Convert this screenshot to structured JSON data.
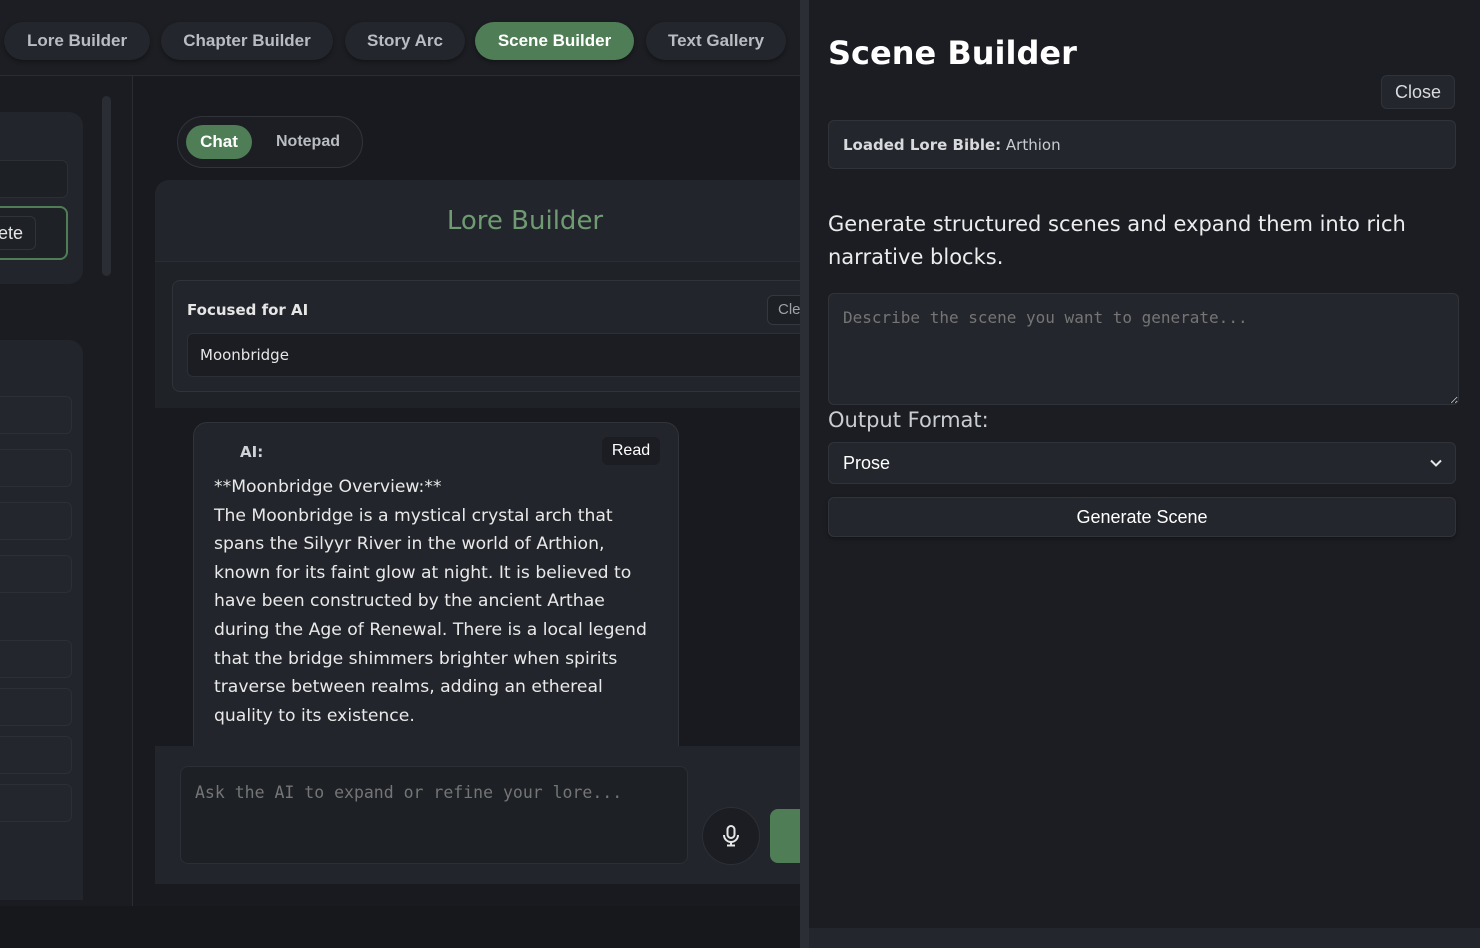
{
  "nav": {
    "tabs": [
      {
        "label": "Lore Builder"
      },
      {
        "label": "Chapter Builder"
      },
      {
        "label": "Story Arc"
      },
      {
        "label": "Scene Builder",
        "active": true
      },
      {
        "label": "Text Gallery"
      }
    ]
  },
  "left": {
    "delete_label": "Delete"
  },
  "chat": {
    "toggle": {
      "chat": "Chat",
      "notepad": "Notepad",
      "active": "Chat"
    },
    "panel_title": "Lore Builder",
    "focus_label": "Focused for AI",
    "clear_label": "Clear",
    "focus_value": "Moonbridge",
    "message": {
      "author": "AI:",
      "read_label": "Read",
      "text": "**Moonbridge Overview:**\nThe Moonbridge is a mystical crystal arch that spans the Silyyr River in the world of Arthion, known for its faint glow at night. It is believed to have been constructed by the ancient Arthae during the Age of Renewal. There is a local legend that the bridge shimmers brighter when spirits traverse between realms, adding an ethereal quality to its existence.\n\n**Expanding the Idea:**"
    },
    "composer_placeholder": "Ask the AI to expand or refine your lore...",
    "mic_icon": "microphone-icon"
  },
  "scene": {
    "title": "Scene Builder",
    "close_label": "Close",
    "lore_label": "Loaded Lore Bible:",
    "lore_value": "Arthion",
    "description": "Generate structured scenes and expand them into rich narrative blocks.",
    "input_placeholder": "Describe the scene you want to generate...",
    "format_label": "Output Format:",
    "format_value": "Prose",
    "generate_label": "Generate Scene"
  },
  "colors": {
    "accent": "#4f7d56",
    "background": "#181a1f",
    "panel": "#22252b"
  }
}
